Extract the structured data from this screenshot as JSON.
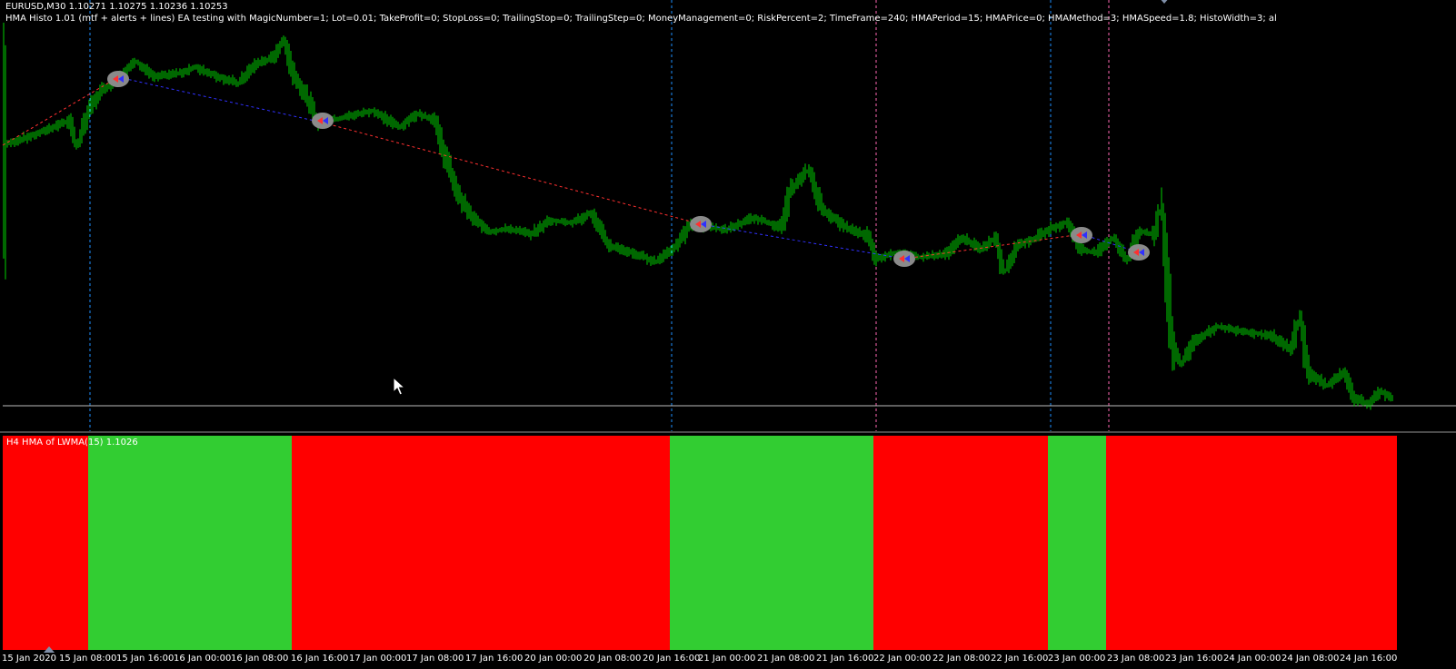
{
  "header": {
    "symbol_line": "EURUSD,M30  1.10271 1.10275 1.10236 1.10253",
    "ea_comment": "HMA Histo 1.01 (mtf + alerts + lines) EA testing with MagicNumber=1; Lot=0.01; TakeProfit=0; StopLoss=0; TrailingStop=0; TrailingStep=0; MoneyManagement=0; RiskPercent=2; TimeFrame=240; HMAPeriod=15; HMAPrice=0; HMAMethod=3; HMASpeed=1.8; HistoWidth=3; al"
  },
  "indicator": {
    "label": "H4 HMA of LWMA(15) 1.1026"
  },
  "time_axis": {
    "labels": [
      "15 Jan 2020",
      "15 Jan 08:00",
      "15 Jan 16:00",
      "16 Jan 00:00",
      "16 Jan 08:00",
      "16 Jan 16:00",
      "17 Jan 00:00",
      "17 Jan 08:00",
      "17 Jan 16:00",
      "20 Jan 00:00",
      "20 Jan 08:00",
      "20 Jan 16:00",
      "21 Jan 00:00",
      "21 Jan 08:00",
      "21 Jan 16:00",
      "22 Jan 00:00",
      "22 Jan 08:00",
      "22 Jan 16:00",
      "23 Jan 00:00",
      "23 Jan 08:00",
      "23 Jan 16:00",
      "24 Jan 00:00",
      "24 Jan 08:00",
      "24 Jan 16:00"
    ]
  },
  "colors": {
    "background": "#000000",
    "bars": "#00d000",
    "histo_up": "#32cd32",
    "histo_down": "#ff0000",
    "buy_line": "#1e90ff",
    "sell_line": "#ff69b4",
    "trade_sell": "#ff3030",
    "trade_buy": "#3030ff",
    "marker_disc": "#8a8a8a",
    "grid_line": "#bcbcbc"
  },
  "icons": {
    "trade_marker": "trade-arrow-icon",
    "cursor": "mouse-pointer-icon",
    "scroll": "chart-shift-triangle-icon"
  }
}
